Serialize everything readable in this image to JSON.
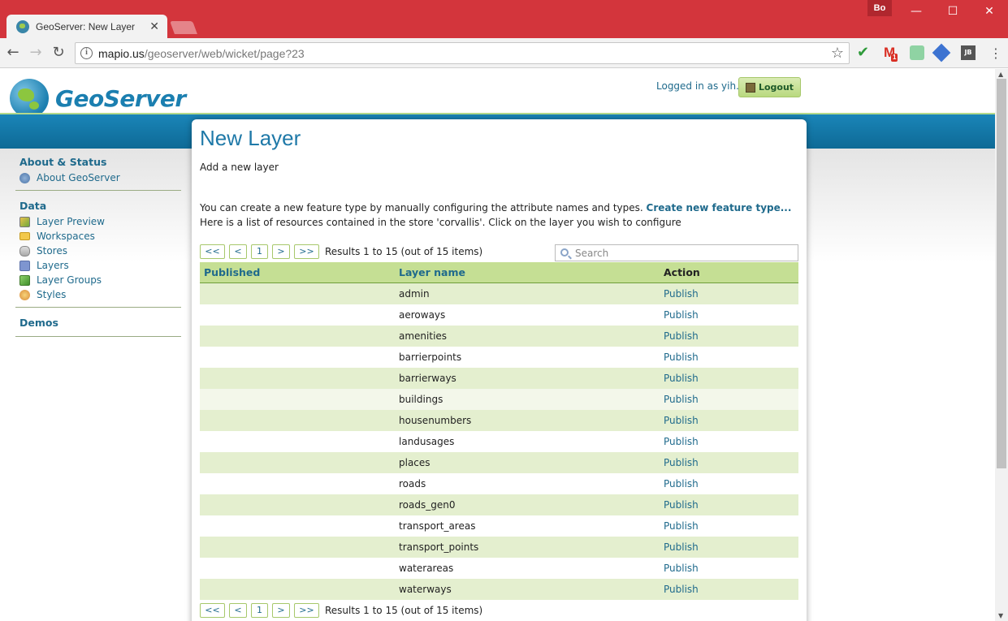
{
  "browser": {
    "tab_title": "GeoServer: New Layer",
    "tab_close": "✕",
    "profile": "Bo",
    "url_domain": "mapio.us",
    "url_path": "/geoserver/web/wicket/page?23",
    "gmail_badge": "1",
    "jb_label": "JB"
  },
  "header": {
    "logo_text": "GeoServer",
    "logged_in": "Logged in as yih.",
    "logout": "Logout"
  },
  "sidebar": {
    "about_heading": "About & Status",
    "about_items": [
      {
        "label": "About GeoServer",
        "icon": "info-icon"
      }
    ],
    "data_heading": "Data",
    "data_items": [
      {
        "label": "Layer Preview",
        "icon": "layer-preview-icon"
      },
      {
        "label": "Workspaces",
        "icon": "folder-icon"
      },
      {
        "label": "Stores",
        "icon": "store-icon"
      },
      {
        "label": "Layers",
        "icon": "layers-icon"
      },
      {
        "label": "Layer Groups",
        "icon": "layer-groups-icon"
      },
      {
        "label": "Styles",
        "icon": "styles-icon"
      }
    ],
    "demos_heading": "Demos"
  },
  "main": {
    "title": "New Layer",
    "subtitle": "Add a new layer",
    "desc_prefix": "You can create a new feature type by manually configuring the attribute names and types.",
    "desc_link": "Create new feature type...",
    "desc2": "Here is a list of resources contained in the store 'corvallis'. Click on the layer you wish to configure",
    "pager": {
      "first": "<<",
      "prev": "<",
      "page": "1",
      "next": ">",
      "last": ">>",
      "results": "Results 1 to 15 (out of 15 items)"
    },
    "search_placeholder": "Search",
    "columns": {
      "published": "Published",
      "layer_name": "Layer name",
      "action": "Action"
    },
    "rows": [
      {
        "published": "",
        "name": "admin",
        "action": "Publish"
      },
      {
        "published": "",
        "name": "aeroways",
        "action": "Publish"
      },
      {
        "published": "",
        "name": "amenities",
        "action": "Publish"
      },
      {
        "published": "",
        "name": "barrierpoints",
        "action": "Publish"
      },
      {
        "published": "",
        "name": "barrierways",
        "action": "Publish"
      },
      {
        "published": "",
        "name": "buildings",
        "action": "Publish"
      },
      {
        "published": "",
        "name": "housenumbers",
        "action": "Publish"
      },
      {
        "published": "",
        "name": "landusages",
        "action": "Publish"
      },
      {
        "published": "",
        "name": "places",
        "action": "Publish"
      },
      {
        "published": "",
        "name": "roads",
        "action": "Publish"
      },
      {
        "published": "",
        "name": "roads_gen0",
        "action": "Publish"
      },
      {
        "published": "",
        "name": "transport_areas",
        "action": "Publish"
      },
      {
        "published": "",
        "name": "transport_points",
        "action": "Publish"
      },
      {
        "published": "",
        "name": "waterareas",
        "action": "Publish"
      },
      {
        "published": "",
        "name": "waterways",
        "action": "Publish"
      }
    ]
  },
  "colors": {
    "titlebar": "#d3353c",
    "brand_blue": "#1f79a8",
    "table_header": "#c5df94",
    "row_stripe": "#e4efcf"
  }
}
